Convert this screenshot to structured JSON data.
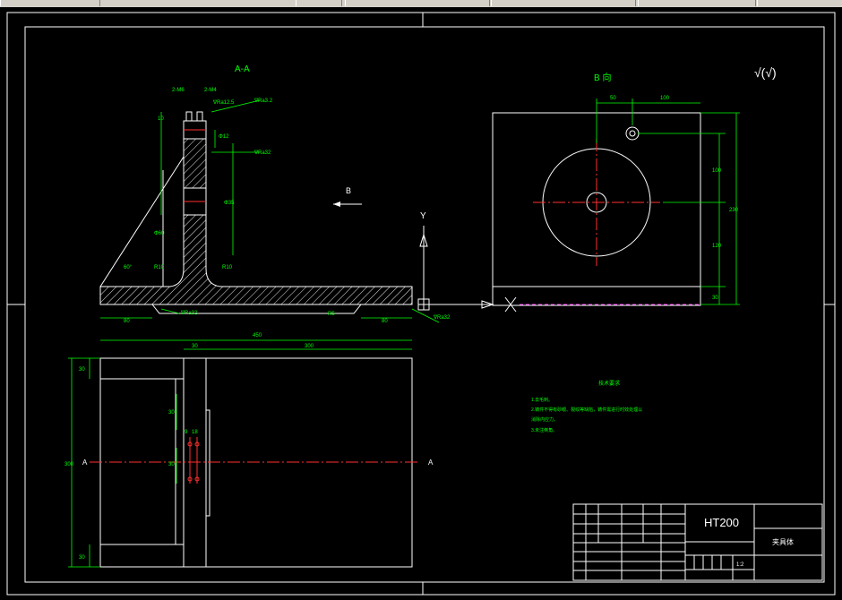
{
  "drawing": {
    "section_label": "A-A",
    "view_b_label": "B 向",
    "arrow_label_b": "B",
    "axis_y_label": "Y",
    "roughness_symbol": "√(√)",
    "section_marks": {
      "left": "A",
      "right": "A"
    },
    "dims_section": [
      "2-M6",
      "2-M4",
      "∇Ra12.5",
      "∇Ra3.2",
      "10",
      "Φ12",
      "∇Ra32",
      "Φ35",
      "Φ60",
      "R10",
      "R10",
      "60°",
      "∇Ra32",
      "80",
      "R5",
      "80",
      "∇Ra32"
    ],
    "dims_top": [
      "30",
      "450",
      "300"
    ],
    "dims_plan": [
      "30",
      "300",
      "30",
      "30",
      "30",
      "9",
      "18"
    ],
    "dims_view_b": [
      "50",
      "100",
      "100",
      "230",
      "120",
      "30"
    ],
    "tech_requirements": {
      "title": "技术要求",
      "lines": [
        "1.去毛刺。",
        "2.铸件不得有砂眼、裂纹等缺陷，铸件需进行时效处理以",
        "消除内应力。",
        "3.未注倒角。"
      ]
    }
  },
  "title_block": {
    "material": "HT200",
    "part_name": "夹具体",
    "scale": "1:2"
  }
}
